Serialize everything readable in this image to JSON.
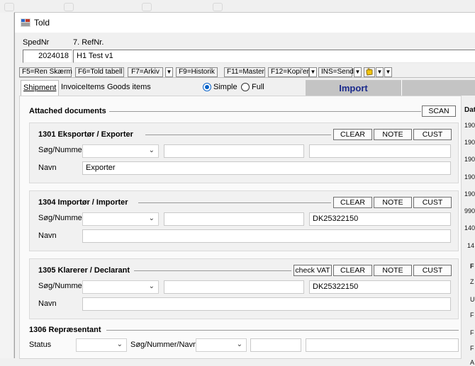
{
  "window": {
    "title": "Told"
  },
  "header": {
    "sped_label": "SpedNr",
    "ref_label": "7. RefNr.",
    "sped_value": "2024018",
    "ref_value": "H1 Test v1"
  },
  "fkeys": [
    "F5=Ren Skærm",
    "F6=Told tabell",
    "F7=Arkiv",
    "F9=Historik",
    "F11=Master",
    "F12=Kopi'er",
    "INS=Send"
  ],
  "tabs": {
    "shipment": "Shipment",
    "invoice": "InvoiceItems",
    "goods": "Goods items"
  },
  "mode": {
    "simple": "Simple",
    "full": "Full",
    "selected": "Simple"
  },
  "import_label": "Import",
  "attached": {
    "title": "Attached documents",
    "scan": "SCAN"
  },
  "buttons": {
    "clear": "CLEAR",
    "note": "NOTE",
    "cust": "CUST",
    "check_vat": "check VAT"
  },
  "exporter": {
    "title": "1301 Eksportør / Exporter",
    "search_label": "Søg/Nummer",
    "name_label": "Navn",
    "name_value": "Exporter",
    "vat": ""
  },
  "importer": {
    "title": "1304 Importør / Importer",
    "search_label": "Søg/Nummer",
    "name_label": "Navn",
    "name_value": "",
    "vat": "DK25322150"
  },
  "declarant": {
    "title": "1305 Klarerer / Declarant",
    "search_label": "Søg/Nummer",
    "name_label": "Navn",
    "name_value": "",
    "vat": "DK25322150"
  },
  "representative": {
    "title": "1306 Repræsentant",
    "status_label": "Status",
    "search_label": "Søg/Nummer/Navn"
  },
  "right_column": {
    "header": "Dat",
    "values": [
      "190",
      "190",
      "190",
      "190",
      "190",
      "990",
      "140",
      "14"
    ],
    "letters": [
      "F",
      "Z",
      "U",
      "F",
      "F",
      "F",
      "A"
    ]
  },
  "colors": {
    "import_text": "#1a2a8c",
    "radio_on": "#0a63c9"
  }
}
